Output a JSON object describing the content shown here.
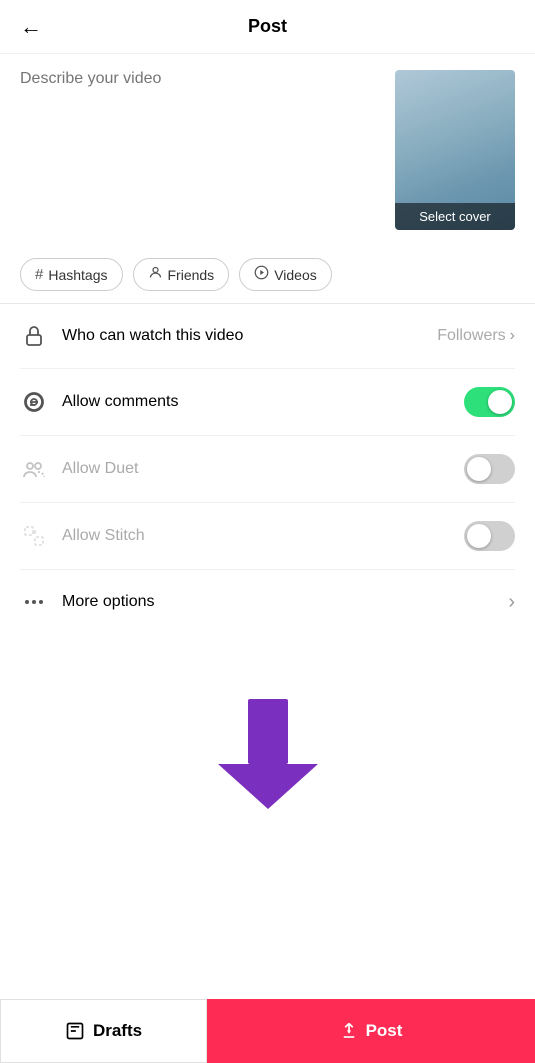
{
  "header": {
    "back_label": "←",
    "title": "Post"
  },
  "description": {
    "placeholder": "Describe your video"
  },
  "cover": {
    "select_label": "Select cover"
  },
  "tags": [
    {
      "id": "hashtags",
      "icon": "#",
      "label": "Hashtags"
    },
    {
      "id": "friends",
      "icon": "@",
      "label": "Friends"
    },
    {
      "id": "videos",
      "icon": "▷",
      "label": "Videos"
    }
  ],
  "settings": [
    {
      "id": "who-can-watch",
      "label": "Who can watch this video",
      "value": "Followers",
      "type": "chevron",
      "disabled": false
    },
    {
      "id": "allow-comments",
      "label": "Allow comments",
      "type": "toggle",
      "on": true,
      "disabled": false
    },
    {
      "id": "allow-duet",
      "label": "Allow Duet",
      "type": "toggle",
      "on": false,
      "disabled": true
    },
    {
      "id": "allow-stitch",
      "label": "Allow Stitch",
      "type": "toggle",
      "on": false,
      "disabled": true
    },
    {
      "id": "more-options",
      "label": "More options",
      "type": "chevron",
      "disabled": false
    }
  ],
  "bottom": {
    "drafts_label": "Drafts",
    "post_label": "Post"
  }
}
